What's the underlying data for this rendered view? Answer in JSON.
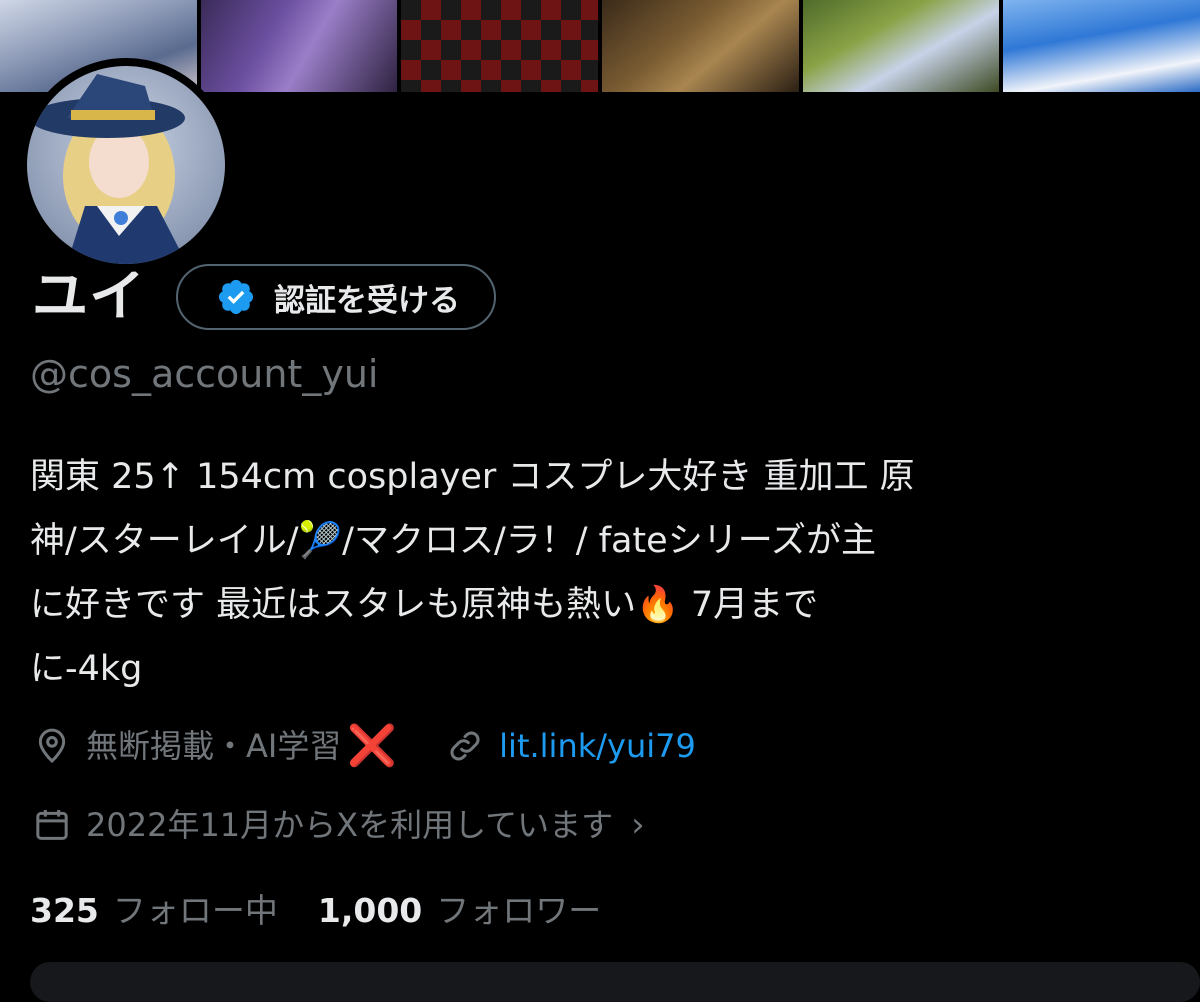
{
  "profile": {
    "display_name": "ユイ",
    "handle": "@cos_account_yui",
    "bio": "関東 25↑ 154cm cosplayer コスプレ大好き 重加工 原\n神/スターレイル/🎾/マクロス/ラ！/ fateシリーズが主\nに好きです 最近はスタレも原神も熱い🔥 7月まで\nに-4kg"
  },
  "verify_button": {
    "label": "認証を受ける",
    "icon": "verified-badge-icon",
    "color": "#1d9bf0"
  },
  "meta": {
    "location": "無断掲載・AI学習",
    "location_icon": "location-pin-icon",
    "location_suffix": "❌",
    "link": "lit.link/yui79",
    "link_icon": "link-icon",
    "joined": "2022年11月からXを利用しています",
    "joined_icon": "calendar-icon",
    "joined_chevron": "›"
  },
  "stats": {
    "following_count": "325",
    "following_label": "フォロー中",
    "followers_count": "1,000",
    "followers_label": "フォロワー"
  },
  "colors": {
    "background": "#000000",
    "text_primary": "#e7e9ea",
    "text_secondary": "#71767b",
    "accent": "#1d9bf0"
  }
}
